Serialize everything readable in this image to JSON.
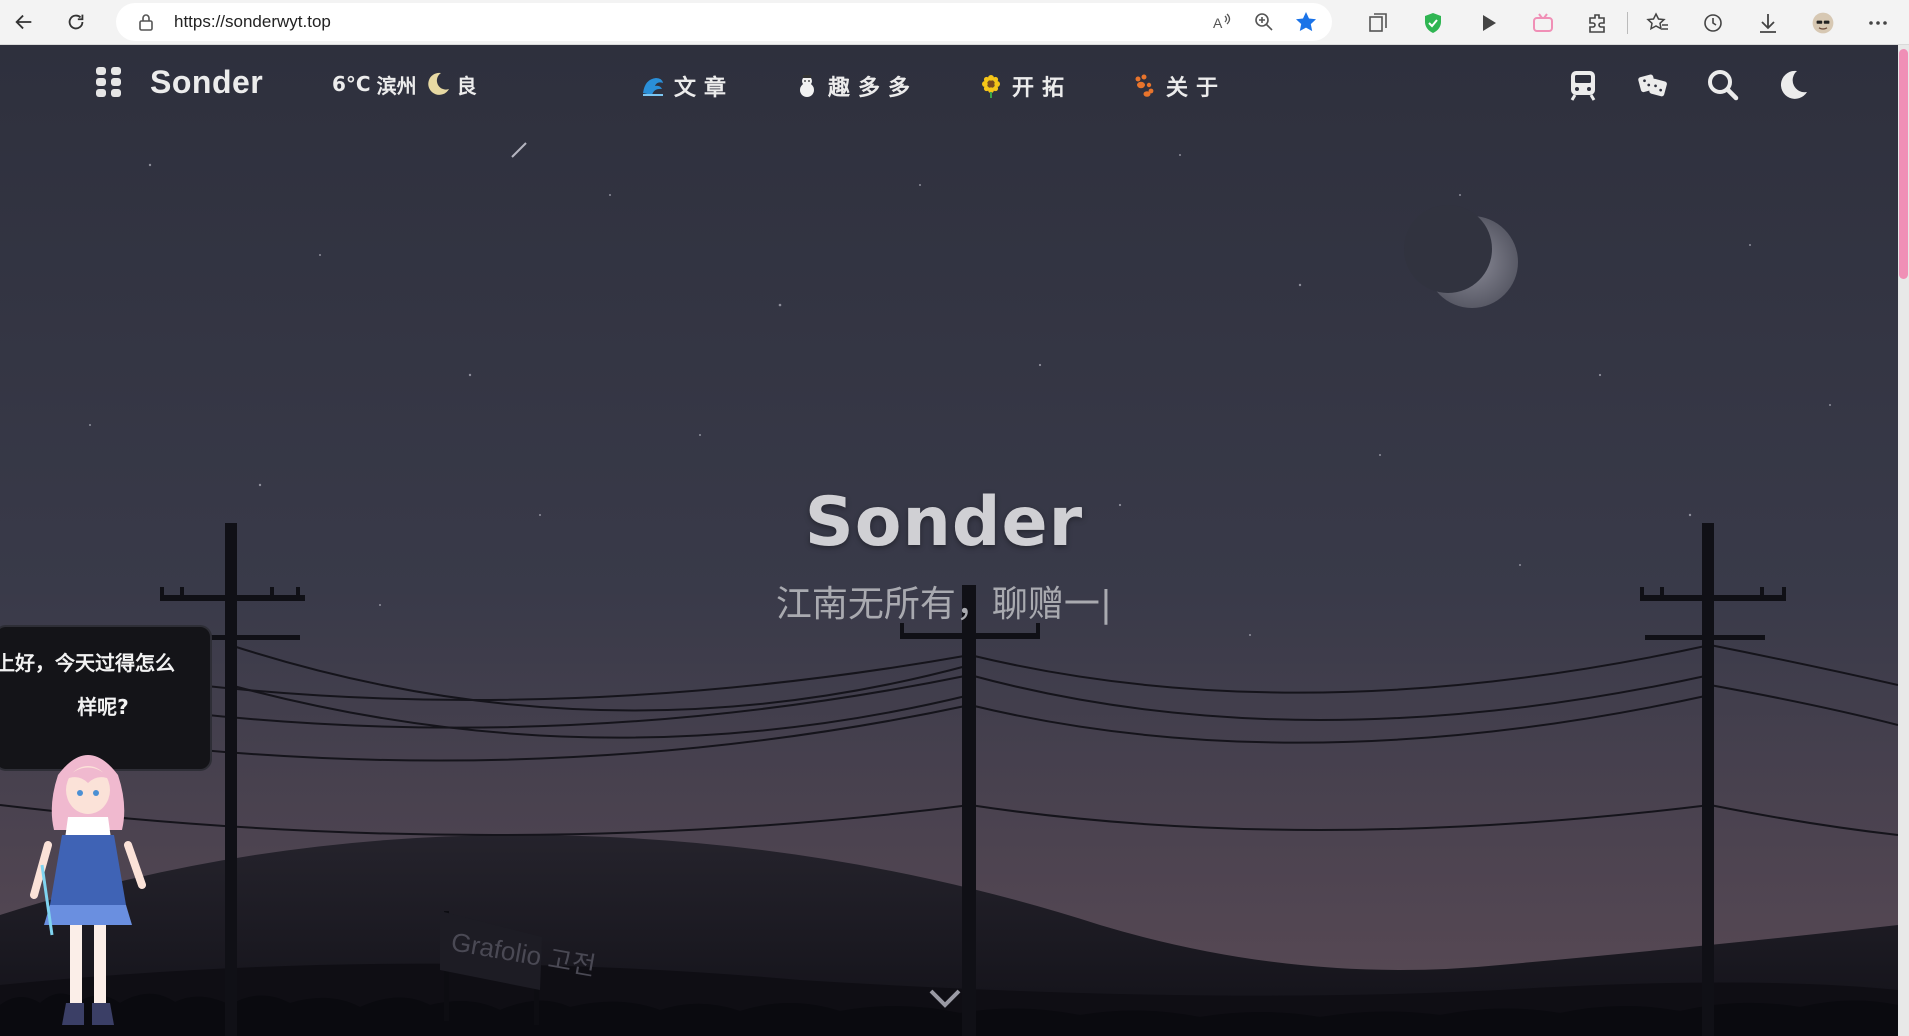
{
  "browser": {
    "url": "https://sonderwyt.top"
  },
  "site": {
    "brand": "Sonder",
    "weather": {
      "temp": "6°C",
      "city": "滨州",
      "air": "良"
    },
    "menu": [
      {
        "label": "文章",
        "icon": "wave-icon"
      },
      {
        "label": "趣多多",
        "icon": "snowman-icon"
      },
      {
        "label": "开拓",
        "icon": "sunflower-icon"
      },
      {
        "label": "关于",
        "icon": "paw-icon"
      }
    ],
    "tools": [
      "train-icon",
      "dice-icon",
      "search-icon",
      "moon-icon"
    ]
  },
  "hero": {
    "title": "Sonder",
    "subtitle": "江南无所有，聊赠一|"
  },
  "mascot": {
    "message_line1": "上好，今天过得怎么",
    "message_line2": "样呢?"
  },
  "scene": {
    "sign_text": "Grafolio 고전"
  },
  "colors": {
    "sky_top": "#2f3140",
    "sky_bottom": "#4a3f4c",
    "accent_pink": "#f08fb6"
  }
}
